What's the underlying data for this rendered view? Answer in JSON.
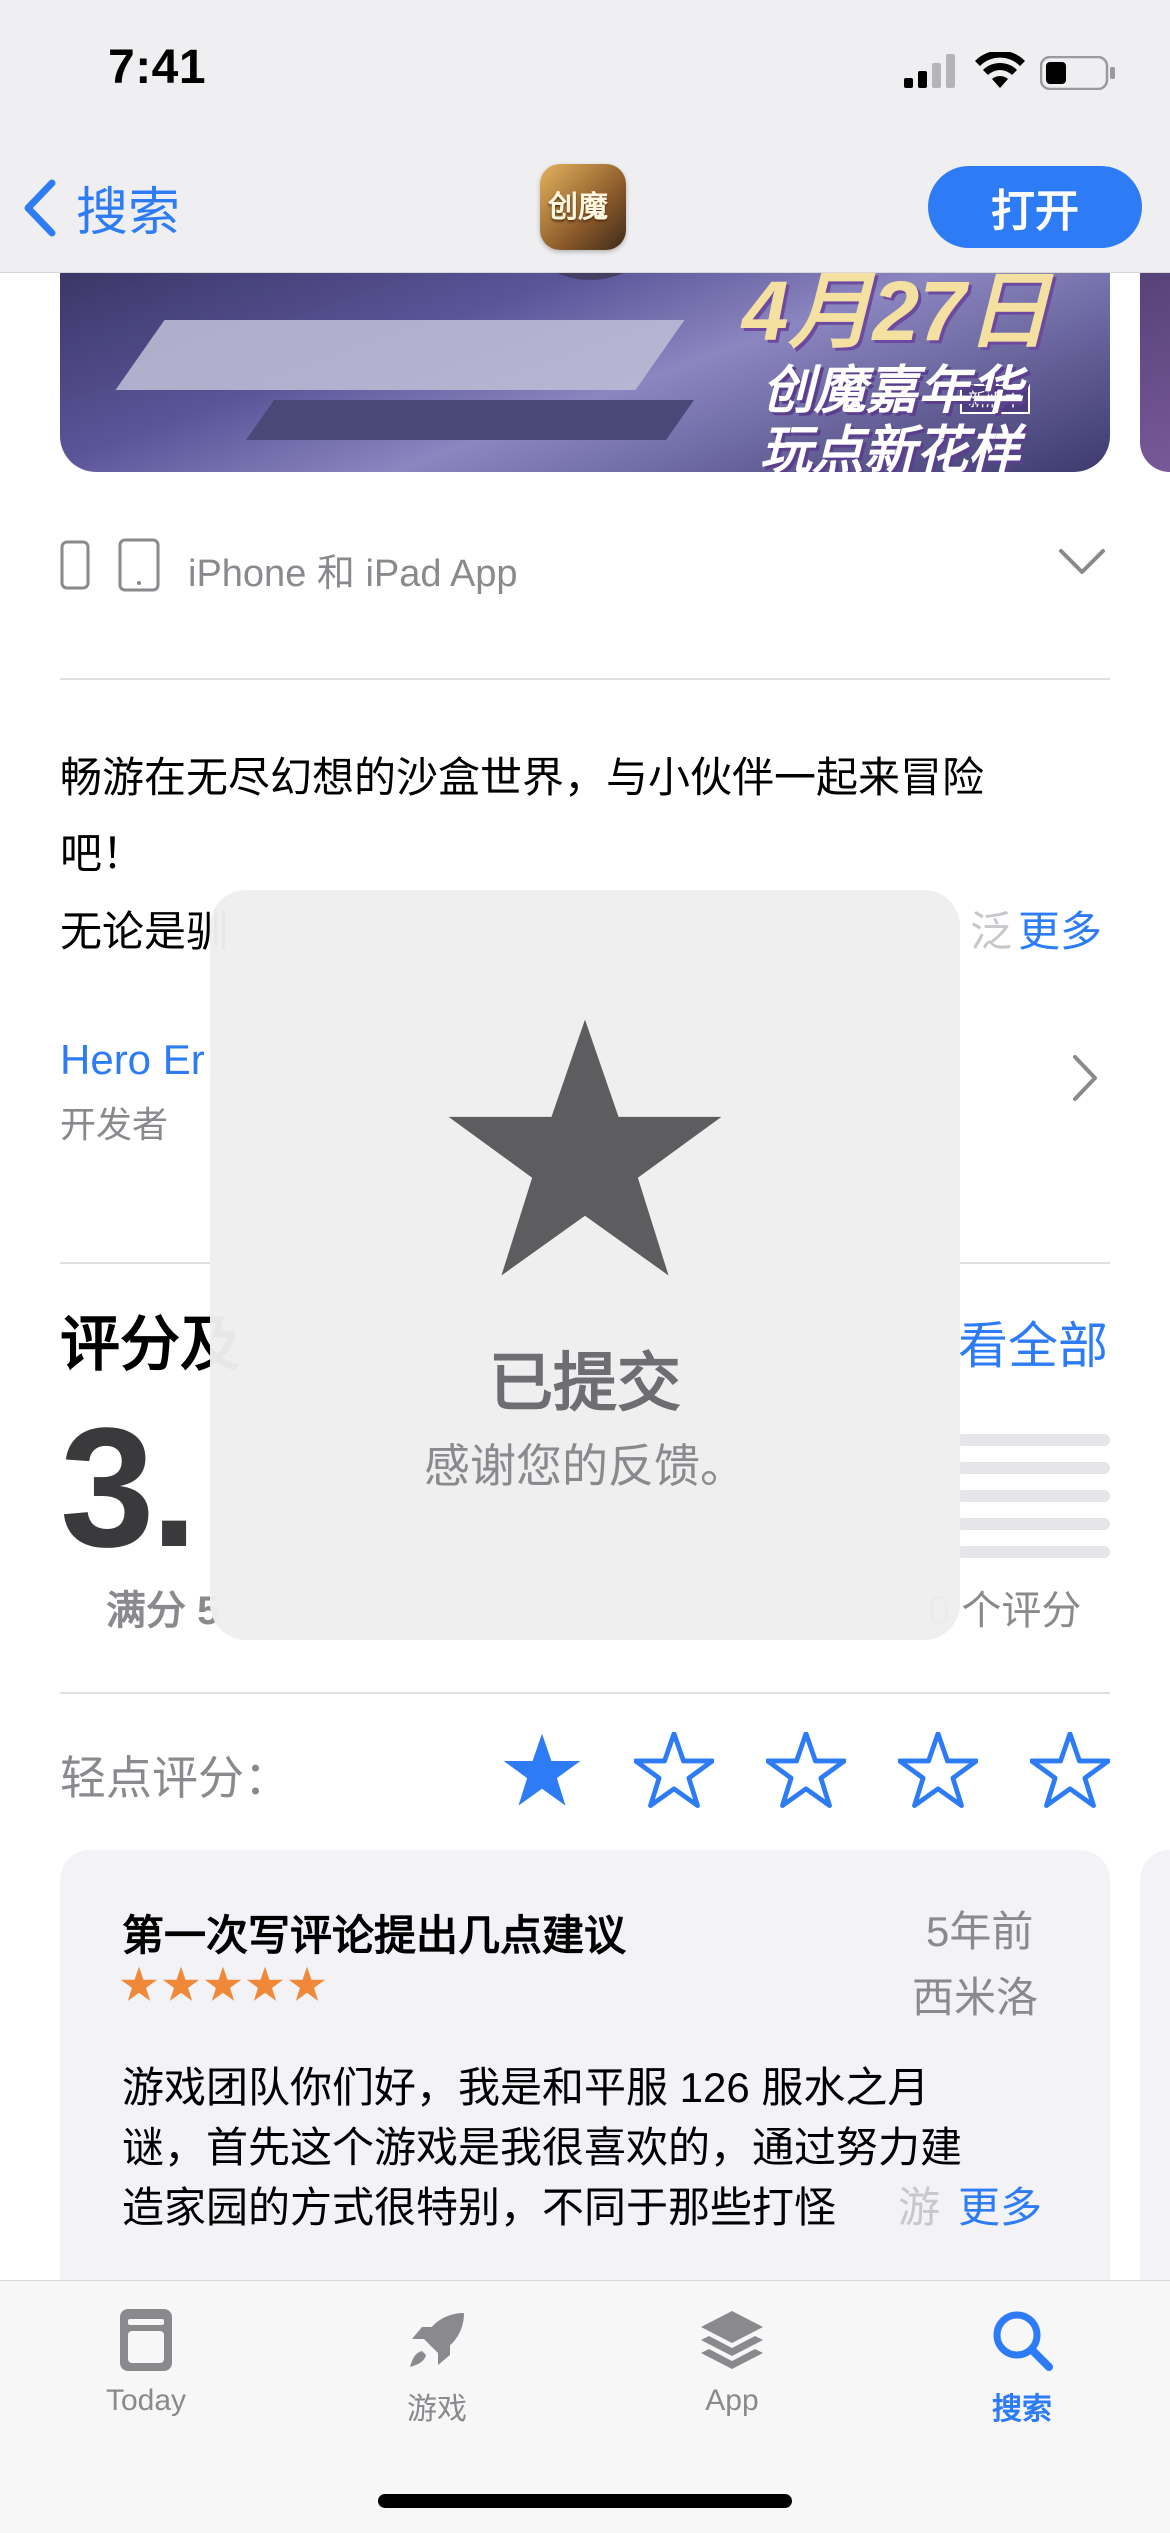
{
  "status_bar": {
    "time": "7:41"
  },
  "nav": {
    "back_label": "搜索",
    "open_label": "打开"
  },
  "banner": {
    "date_text": "4月27日",
    "line1": "创魔嘉年华",
    "line2": "玩点新花样",
    "tag": "新版本"
  },
  "platform": {
    "label": "iPhone 和 iPad App"
  },
  "description": {
    "line1": "畅游在无尽幻想的沙盒世界，与小伙伴一起来冒险",
    "line2": "吧！",
    "line3": "无论是驯",
    "fade": "泛",
    "more": "更多"
  },
  "developer": {
    "name": "Hero Er",
    "label": "开发者"
  },
  "ratings": {
    "title": "评分及",
    "see_all": "看全部",
    "score": "3.",
    "out_of": "满分 5",
    "count": "0 个评分"
  },
  "tap_to_rate": {
    "label": "轻点评分：",
    "selected": 1,
    "max": 5
  },
  "review": {
    "title": "第一次写评论提出几点建议",
    "date": "5年前",
    "author": "西米洛",
    "stars": 5,
    "line1": "游戏团队你们好，我是和平服 126 服水之月",
    "line2": "谜，首先这个游戏是我很喜欢的，通过努力建",
    "line3": "造家园的方式很特别，不同于那些打怪",
    "fade": "游",
    "more": "更多"
  },
  "hud": {
    "title": "已提交",
    "subtitle": "感谢您的反馈。"
  },
  "tabbar": {
    "tabs": [
      {
        "label": "Today",
        "icon": "today-icon"
      },
      {
        "label": "游戏",
        "icon": "rocket-icon"
      },
      {
        "label": "App",
        "icon": "layers-icon"
      },
      {
        "label": "搜索",
        "icon": "search-icon"
      }
    ],
    "active": "搜索"
  },
  "colors": {
    "accent": "#2d7cf6",
    "star_orange": "#f0883a",
    "hud_star": "#5d5d60"
  }
}
